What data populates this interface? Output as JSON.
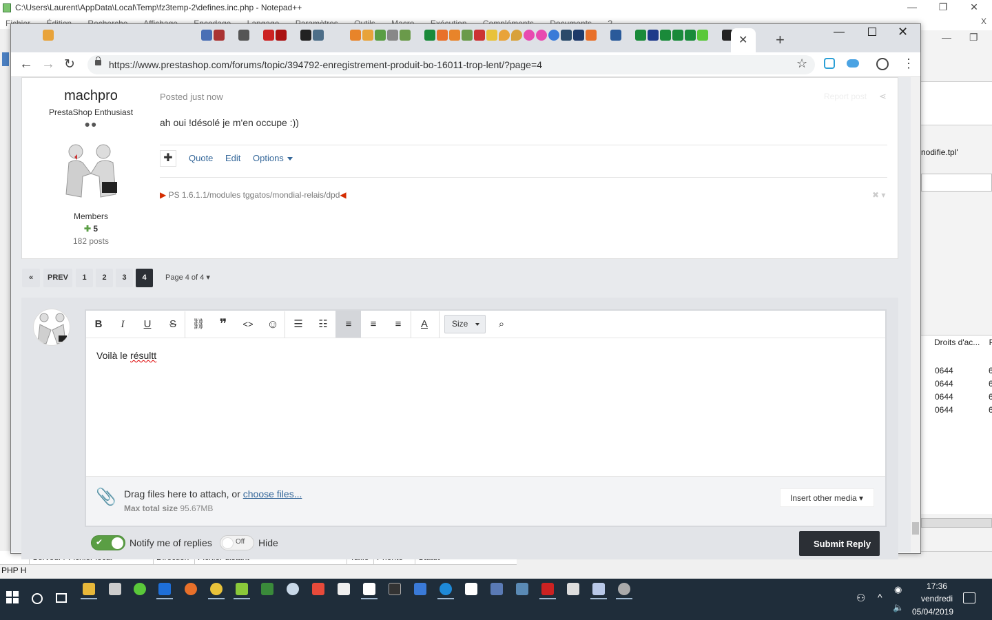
{
  "notepad": {
    "title": "C:\\Users\\Laurent\\AppData\\Local\\Temp\\fz3temp-2\\defines.inc.php - Notepad++",
    "menu": [
      "Fichier",
      "Édition",
      "Recherche",
      "Affichage",
      "Encodage",
      "Langage",
      "Paramètres",
      "Outils",
      "Macro",
      "Exécution",
      "Compléments",
      "Documents",
      "?"
    ],
    "min": "—",
    "max": "❐",
    "close": "✕",
    "close_small": "X",
    "status_left": "PHP H"
  },
  "filezilla": {
    "filename": "nodifie.tpl'",
    "column_permissions": "Droits d'ac...",
    "column_extra": "P",
    "permissions": [
      "0644",
      "0644",
      "0644",
      "0644"
    ],
    "trail": "6",
    "queue_columns": [
      "Serveur / Fichier local",
      "Direction",
      "Fichier distant",
      "Taille",
      "Priorité",
      "Statut"
    ]
  },
  "browser": {
    "url": "https://www.prestashop.com/forums/topic/394792-enregistrement-produit-bo-16011-trop-lent/?page=4",
    "tab_close": "✕",
    "new_tab": "+",
    "min": "—",
    "close": "✕",
    "back": "←",
    "forward": "→",
    "reload": "↻",
    "star": "☆",
    "menu": "⋮"
  },
  "post": {
    "author_name": "machpro",
    "author_rank": "PrestaShop Enthusiast",
    "rank_dots": "●●",
    "author_group": "Members",
    "reputation": "5",
    "posts_count": "182 posts",
    "posted": "Posted just now",
    "report": "Report post",
    "share_icon": "⋖",
    "body": "ah oui !désolé je m'en occupe :))",
    "react": "✚",
    "actions": [
      "Quote",
      "Edit",
      "Options"
    ],
    "signature": "PS 1.6.1.1/modules tggatos/mondial-relais/dpd",
    "sig_toggle": "✖ ▾"
  },
  "pagination": {
    "first": "«",
    "prev": "PREV",
    "pages": [
      "1",
      "2",
      "3",
      "4"
    ],
    "current": "4",
    "jump": "Page 4 of 4 ▾"
  },
  "editor": {
    "tools": {
      "bold": "B",
      "italic": "I",
      "underline": "U",
      "strike": "S",
      "link": "⛓",
      "quote": "❞",
      "code": "<>",
      "emoji": "☺",
      "bullets": "☰",
      "numbers": "☷",
      "align_left": "≡",
      "align_center": "≡",
      "align_right": "≡",
      "font_color": "A",
      "preview": "⌕"
    },
    "size_label": "Size",
    "text_prefix": "Voilà le ",
    "text_misspelled": "résultt",
    "attach_text": "Drag files here to attach, or ",
    "choose_files": "choose files...",
    "max_size_label": "Max total size",
    "max_size_value": " 95.67MB",
    "insert_media": "Insert other media ▾",
    "clip_icon": "📎",
    "notify_label": "Notify me of replies",
    "notify_state": "✔",
    "hide_label": "Hide",
    "hide_state": "Off",
    "submit": "Submit Reply"
  },
  "taskbar": {
    "time": "17:36",
    "day": "vendredi",
    "date": "05/04/2019",
    "tray_people": "⚇",
    "tray_chevron": "^",
    "tray_wifi": "◉",
    "tray_volume": "🔈"
  },
  "colors": {
    "accent_dark": "#2b2f35",
    "link": "#336699",
    "toggle_on": "#5a9e44",
    "taskbar": "#1f2d3a"
  }
}
